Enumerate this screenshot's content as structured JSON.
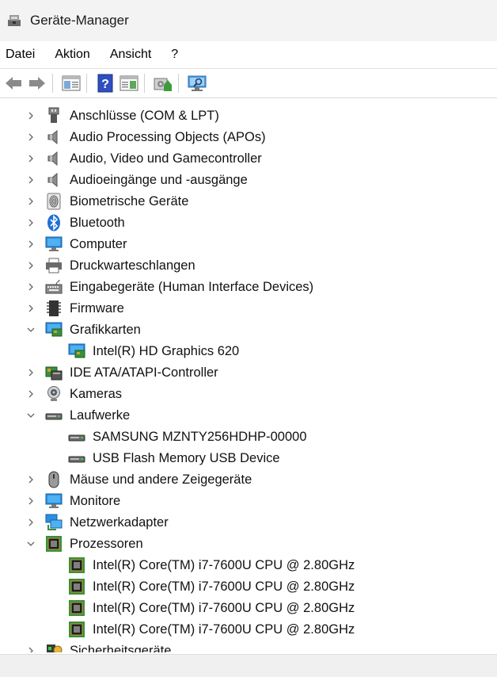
{
  "window": {
    "title": "Geräte-Manager"
  },
  "menu": [
    "Datei",
    "Aktion",
    "Ansicht",
    "?"
  ],
  "tree": [
    {
      "label": "Anschlüsse (COM & LPT)",
      "icon": "port-icon",
      "level": 0,
      "expanded": false
    },
    {
      "label": "Audio Processing Objects (APOs)",
      "icon": "speaker-icon",
      "level": 0,
      "expanded": false
    },
    {
      "label": "Audio, Video und Gamecontroller",
      "icon": "speaker-icon",
      "level": 0,
      "expanded": false
    },
    {
      "label": "Audioeingänge und -ausgänge",
      "icon": "speaker-icon",
      "level": 0,
      "expanded": false
    },
    {
      "label": "Biometrische Geräte",
      "icon": "fingerprint-icon",
      "level": 0,
      "expanded": false
    },
    {
      "label": "Bluetooth",
      "icon": "bluetooth-icon",
      "level": 0,
      "expanded": false
    },
    {
      "label": "Computer",
      "icon": "monitor-icon",
      "level": 0,
      "expanded": false
    },
    {
      "label": "Druckwarteschlangen",
      "icon": "printer-icon",
      "level": 0,
      "expanded": false
    },
    {
      "label": "Eingabegeräte (Human Interface Devices)",
      "icon": "keyboard-icon",
      "level": 0,
      "expanded": false
    },
    {
      "label": "Firmware",
      "icon": "chip-icon",
      "level": 0,
      "expanded": false
    },
    {
      "label": "Grafikkarten",
      "icon": "display-adapter-icon",
      "level": 0,
      "expanded": true
    },
    {
      "label": "Intel(R) HD Graphics 620",
      "icon": "display-adapter-icon",
      "level": 1
    },
    {
      "label": "IDE ATA/ATAPI-Controller",
      "icon": "ide-controller-icon",
      "level": 0,
      "expanded": false
    },
    {
      "label": "Kameras",
      "icon": "webcam-icon",
      "level": 0,
      "expanded": false
    },
    {
      "label": "Laufwerke",
      "icon": "drive-icon",
      "level": 0,
      "expanded": true
    },
    {
      "label": "SAMSUNG MZNTY256HDHP-00000",
      "icon": "drive-icon",
      "level": 1
    },
    {
      "label": "USB Flash Memory USB Device",
      "icon": "drive-icon",
      "level": 1
    },
    {
      "label": "Mäuse und andere Zeigegeräte",
      "icon": "mouse-icon",
      "level": 0,
      "expanded": false
    },
    {
      "label": "Monitore",
      "icon": "monitor-icon",
      "level": 0,
      "expanded": false
    },
    {
      "label": "Netzwerkadapter",
      "icon": "network-icon",
      "level": 0,
      "expanded": false
    },
    {
      "label": "Prozessoren",
      "icon": "cpu-icon",
      "level": 0,
      "expanded": true
    },
    {
      "label": "Intel(R) Core(TM) i7-7600U CPU @ 2.80GHz",
      "icon": "cpu-icon",
      "level": 1
    },
    {
      "label": "Intel(R) Core(TM) i7-7600U CPU @ 2.80GHz",
      "icon": "cpu-icon",
      "level": 1
    },
    {
      "label": "Intel(R) Core(TM) i7-7600U CPU @ 2.80GHz",
      "icon": "cpu-icon",
      "level": 1
    },
    {
      "label": "Intel(R) Core(TM) i7-7600U CPU @ 2.80GHz",
      "icon": "cpu-icon",
      "level": 1
    },
    {
      "label": "Sicherheitsgeräte",
      "icon": "security-device-icon",
      "level": 0,
      "expanded": false
    }
  ]
}
